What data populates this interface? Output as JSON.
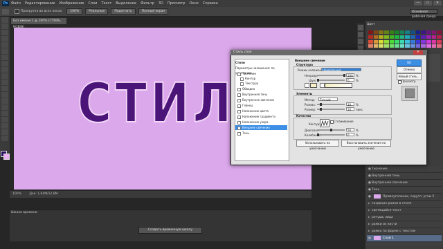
{
  "menu": {
    "logo": "Ps",
    "items": [
      "Файл",
      "Редактирование",
      "Изображение",
      "Слои",
      "Текст",
      "Выделение",
      "Фильтр",
      "3D",
      "Просмотр",
      "Окно",
      "Справка"
    ],
    "window_controls": [
      "—",
      "▭",
      "✕"
    ]
  },
  "options": {
    "scroll_all_label": "Прокрутка во всех окнах",
    "zoom": "100%",
    "actual_pixels": "Реальные",
    "fit_screen": "Подогнать",
    "fill_screen": "Полный экран",
    "workspace": "Основная рабочая среда"
  },
  "document": {
    "tab_title": "Без имени-1 @ 100% (СТИЛЬ, RGB/8)",
    "canvas_color": "#dca8ec",
    "big_text": "СТИЛЬ",
    "text_color": "#4a1478",
    "zoom_status": "100%",
    "doc_status": "Док: 1,64M/12,8M"
  },
  "timeline": {
    "tab": "Шкала времени",
    "create_button": "Создать временную шкалу"
  },
  "right_panel": {
    "color_tab": "Цвет",
    "layers": [
      "Тиснение",
      "Внутренняя тень",
      "Внутреннее свечение",
      "Тень",
      "Прямоугольник, скругл. углы 5",
      "создание рамки в стиле",
      "светящийся текст",
      "ретушь лица",
      "рамки из кисти",
      "рамка по форме с текстом",
      "Слой 1"
    ]
  },
  "dialog": {
    "title": "Стиль слоя",
    "close": "✕",
    "styles_header": "Стили",
    "blend_options": "Параметры наложения: по умолчанию",
    "styles": [
      "Тиснение",
      "Контур",
      "Текстура",
      "Обводка",
      "Внутренняя тень",
      "Внутреннее свечение",
      "Глянец",
      "Наложение цвета",
      "Наложение градиента",
      "Наложение узора",
      "Внешнее свечение",
      "Тень"
    ],
    "selected_style": "Внешнее свечение",
    "panel_title": "Внешнее свечение",
    "structure": {
      "label": "Структура",
      "blend_mode_label": "Режим наложения:",
      "blend_mode": "Нормальный",
      "opacity_label": "Непрозр.:",
      "opacity": "100",
      "noise_label": "Шум:",
      "noise": "0",
      "percent": "%"
    },
    "elements": {
      "label": "Элементы",
      "method_label": "Метод:",
      "method": "Точный",
      "spread_label": "Размах:",
      "spread": "10",
      "size_label": "Размер:",
      "size": "10",
      "px": "пикс."
    },
    "quality": {
      "label": "Качество",
      "contour_label": "Контур:",
      "antialias_label": "Сглаживание",
      "range_label": "Диапазон:",
      "range": "50",
      "jitter_label": "Колебание:",
      "jitter": "0"
    },
    "make_default": "Использовать по умолчанию",
    "reset_default": "Восстановить значения по умолчанию",
    "buttons": {
      "ok": "OK",
      "cancel": "Отмена",
      "new_style": "Новый стиль...",
      "preview": "Просмотр"
    }
  }
}
